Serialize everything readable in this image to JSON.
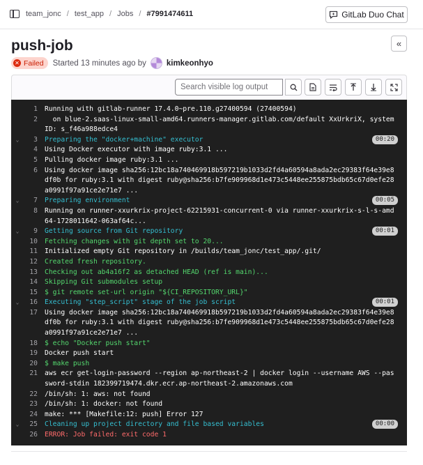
{
  "breadcrumb": [
    "team_jonc",
    "test_app",
    "Jobs",
    "#7991474611"
  ],
  "duo_button": "GitLab Duo Chat",
  "job": {
    "title": "push-job",
    "status": "Failed",
    "started": "Started 13 minutes ago by",
    "author": "kimkeonhyo"
  },
  "search": {
    "placeholder": "Search visible log output"
  },
  "log_lines": [
    {
      "n": "1",
      "text": "Running with gitlab-runner 17.4.0~pre.110.g27400594 (27400594)",
      "style": ""
    },
    {
      "n": "2",
      "text": "  on blue-2.saas-linux-small-amd64.runners-manager.gitlab.com/default XxUrkriX, system ID: s_f46a988edce4",
      "style": ""
    },
    {
      "n": "3",
      "text": "Preparing the \"docker+machine\" executor",
      "style": "cyan",
      "dur": "00:20"
    },
    {
      "n": "4",
      "text": "Using Docker executor with image ruby:3.1 ...",
      "style": ""
    },
    {
      "n": "5",
      "text": "Pulling docker image ruby:3.1 ...",
      "style": ""
    },
    {
      "n": "6",
      "text": "Using docker image sha256:12bc18a740469918b597219b1033d2fd4a60594a8ada2ec29383f64e39e8df0b for ruby:3.1 with digest ruby@sha256:b7fe909968d1e473c5448ee255875bdb65c67d0efe28a0991f97a91ce2e71e7 ...",
      "style": ""
    },
    {
      "n": "7",
      "text": "Preparing environment",
      "style": "cyan",
      "dur": "00:05"
    },
    {
      "n": "8",
      "text": "Running on runner-xxurkrix-project-62215931-concurrent-0 via runner-xxurkrix-s-l-s-amd64-1728011642-063af64c...",
      "style": ""
    },
    {
      "n": "9",
      "text": "Getting source from Git repository",
      "style": "cyan",
      "dur": "00:01"
    },
    {
      "n": "10",
      "text": "Fetching changes with git depth set to 20...",
      "style": "green"
    },
    {
      "n": "11",
      "text": "Initialized empty Git repository in /builds/team_jonc/test_app/.git/",
      "style": ""
    },
    {
      "n": "12",
      "text": "Created fresh repository.",
      "style": "green"
    },
    {
      "n": "13",
      "text": "Checking out ab4a16f2 as detached HEAD (ref is main)...",
      "style": "green"
    },
    {
      "n": "14",
      "text": "Skipping Git submodules setup",
      "style": "green"
    },
    {
      "n": "15",
      "text": "$ git remote set-url origin \"${CI_REPOSITORY_URL}\"",
      "style": "green"
    },
    {
      "n": "16",
      "text": "Executing \"step_script\" stage of the job script",
      "style": "cyan",
      "dur": "00:01"
    },
    {
      "n": "17",
      "text": "Using docker image sha256:12bc18a740469918b597219b1033d2fd4a60594a8ada2ec29383f64e39e8df0b for ruby:3.1 with digest ruby@sha256:b7fe909968d1e473c5448ee255875bdb65c67d0efe28a0991f97a91ce2e71e7 ...",
      "style": ""
    },
    {
      "n": "18",
      "text": "$ echo \"Docker push start\"",
      "style": "green"
    },
    {
      "n": "19",
      "text": "Docker push start",
      "style": ""
    },
    {
      "n": "20",
      "text": "$ make push",
      "style": "green"
    },
    {
      "n": "21",
      "text": "aws ecr get-login-password --region ap-northeast-2 | docker login --username AWS --password-stdin 182399719474.dkr.ecr.ap-northeast-2.amazonaws.com",
      "style": ""
    },
    {
      "n": "22",
      "text": "/bin/sh: 1: aws: not found",
      "style": ""
    },
    {
      "n": "23",
      "text": "/bin/sh: 1: docker: not found",
      "style": ""
    },
    {
      "n": "24",
      "text": "make: *** [Makefile:12: push] Error 127",
      "style": ""
    },
    {
      "n": "25",
      "text": "Cleaning up project directory and file based variables",
      "style": "cyan",
      "dur": "00:00"
    },
    {
      "n": "26",
      "text": "ERROR: Job failed: exit code 1",
      "style": "red"
    }
  ]
}
